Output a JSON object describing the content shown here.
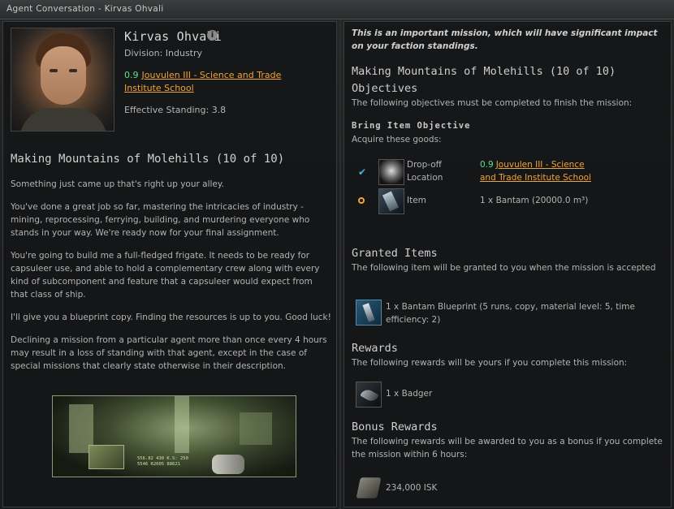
{
  "window": {
    "title": "Agent Conversation - Kirvas Ohvali"
  },
  "agent": {
    "name": "Kirvas Ohvali",
    "division": "Division: Industry",
    "security": "0.9",
    "location_line1": "Jouvulen III - Science and Trade",
    "location_line2": "Institute School",
    "standing": "Effective Standing: 3.8"
  },
  "mission": {
    "title": "Making Mountains of Molehills (10 of 10)",
    "briefing": [
      "Something just came up that's right up your alley.",
      "You've done a great job so far, mastering the intricacies of industry - mining, reprocessing, ferrying, building, and murdering everyone who stands in your way. We're ready now for your final assignment.",
      "You're going to build me a full-fledged frigate. It needs to be ready for capsuleer use, and able to hold a complementary crew along with every kind of subcomponent and feature that a capsuleer would expect from that class of ship.",
      "I'll give you a blueprint copy. Finding the resources is up to you. Good luck!",
      "Declining a mission from a particular agent more than once every 4 hours may result in a loss of standing with that agent, except in the case of special missions that clearly state otherwise in their description."
    ],
    "image_readout": [
      "556.82 430 K.S: 250",
      "5546 R2005 88621"
    ]
  },
  "details": {
    "important_note": "This is an important mission, which will have significant impact on your faction standings.",
    "mission_title": "Making Mountains of Molehills (10 of 10)",
    "objectives_heading": "Objectives",
    "objectives_text": "The following objectives must be completed to finish the mission:",
    "bring_item_label": "Bring Item Objective",
    "acquire_text": "Acquire these goods:",
    "dropoff_label_1": "Drop-off",
    "dropoff_label_2": "Location",
    "dropoff_security": "0.9",
    "dropoff_location_1": "Jouvulen III - Science",
    "dropoff_location_2": "and Trade Institute School",
    "item_label": "Item",
    "item_value": "1 x Bantam (20000.0 m³)",
    "granted_heading": "Granted Items",
    "granted_text": "The following item will be granted to you when the mission is accepted",
    "granted_item": "1 x Bantam Blueprint (5 runs, copy, material level: 5, time efficiency: 2)",
    "rewards_heading": "Rewards",
    "rewards_text": "The following rewards will be yours if you complete this mission:",
    "reward_item": "1 x Badger",
    "bonus_heading": "Bonus Rewards",
    "bonus_text": "The following rewards will be awarded to you as a bonus if you complete the mission within 6 hours:",
    "bonus_item": "234,000 ISK"
  },
  "colors": {
    "security": "#5ae08a",
    "link": "#f0a43a",
    "check": "#3fb6e8"
  },
  "icons": [
    "info-icon",
    "check-icon",
    "circle-icon",
    "bantam-icon",
    "blueprint-icon",
    "badger-icon",
    "isk-icon",
    "station-icon"
  ]
}
